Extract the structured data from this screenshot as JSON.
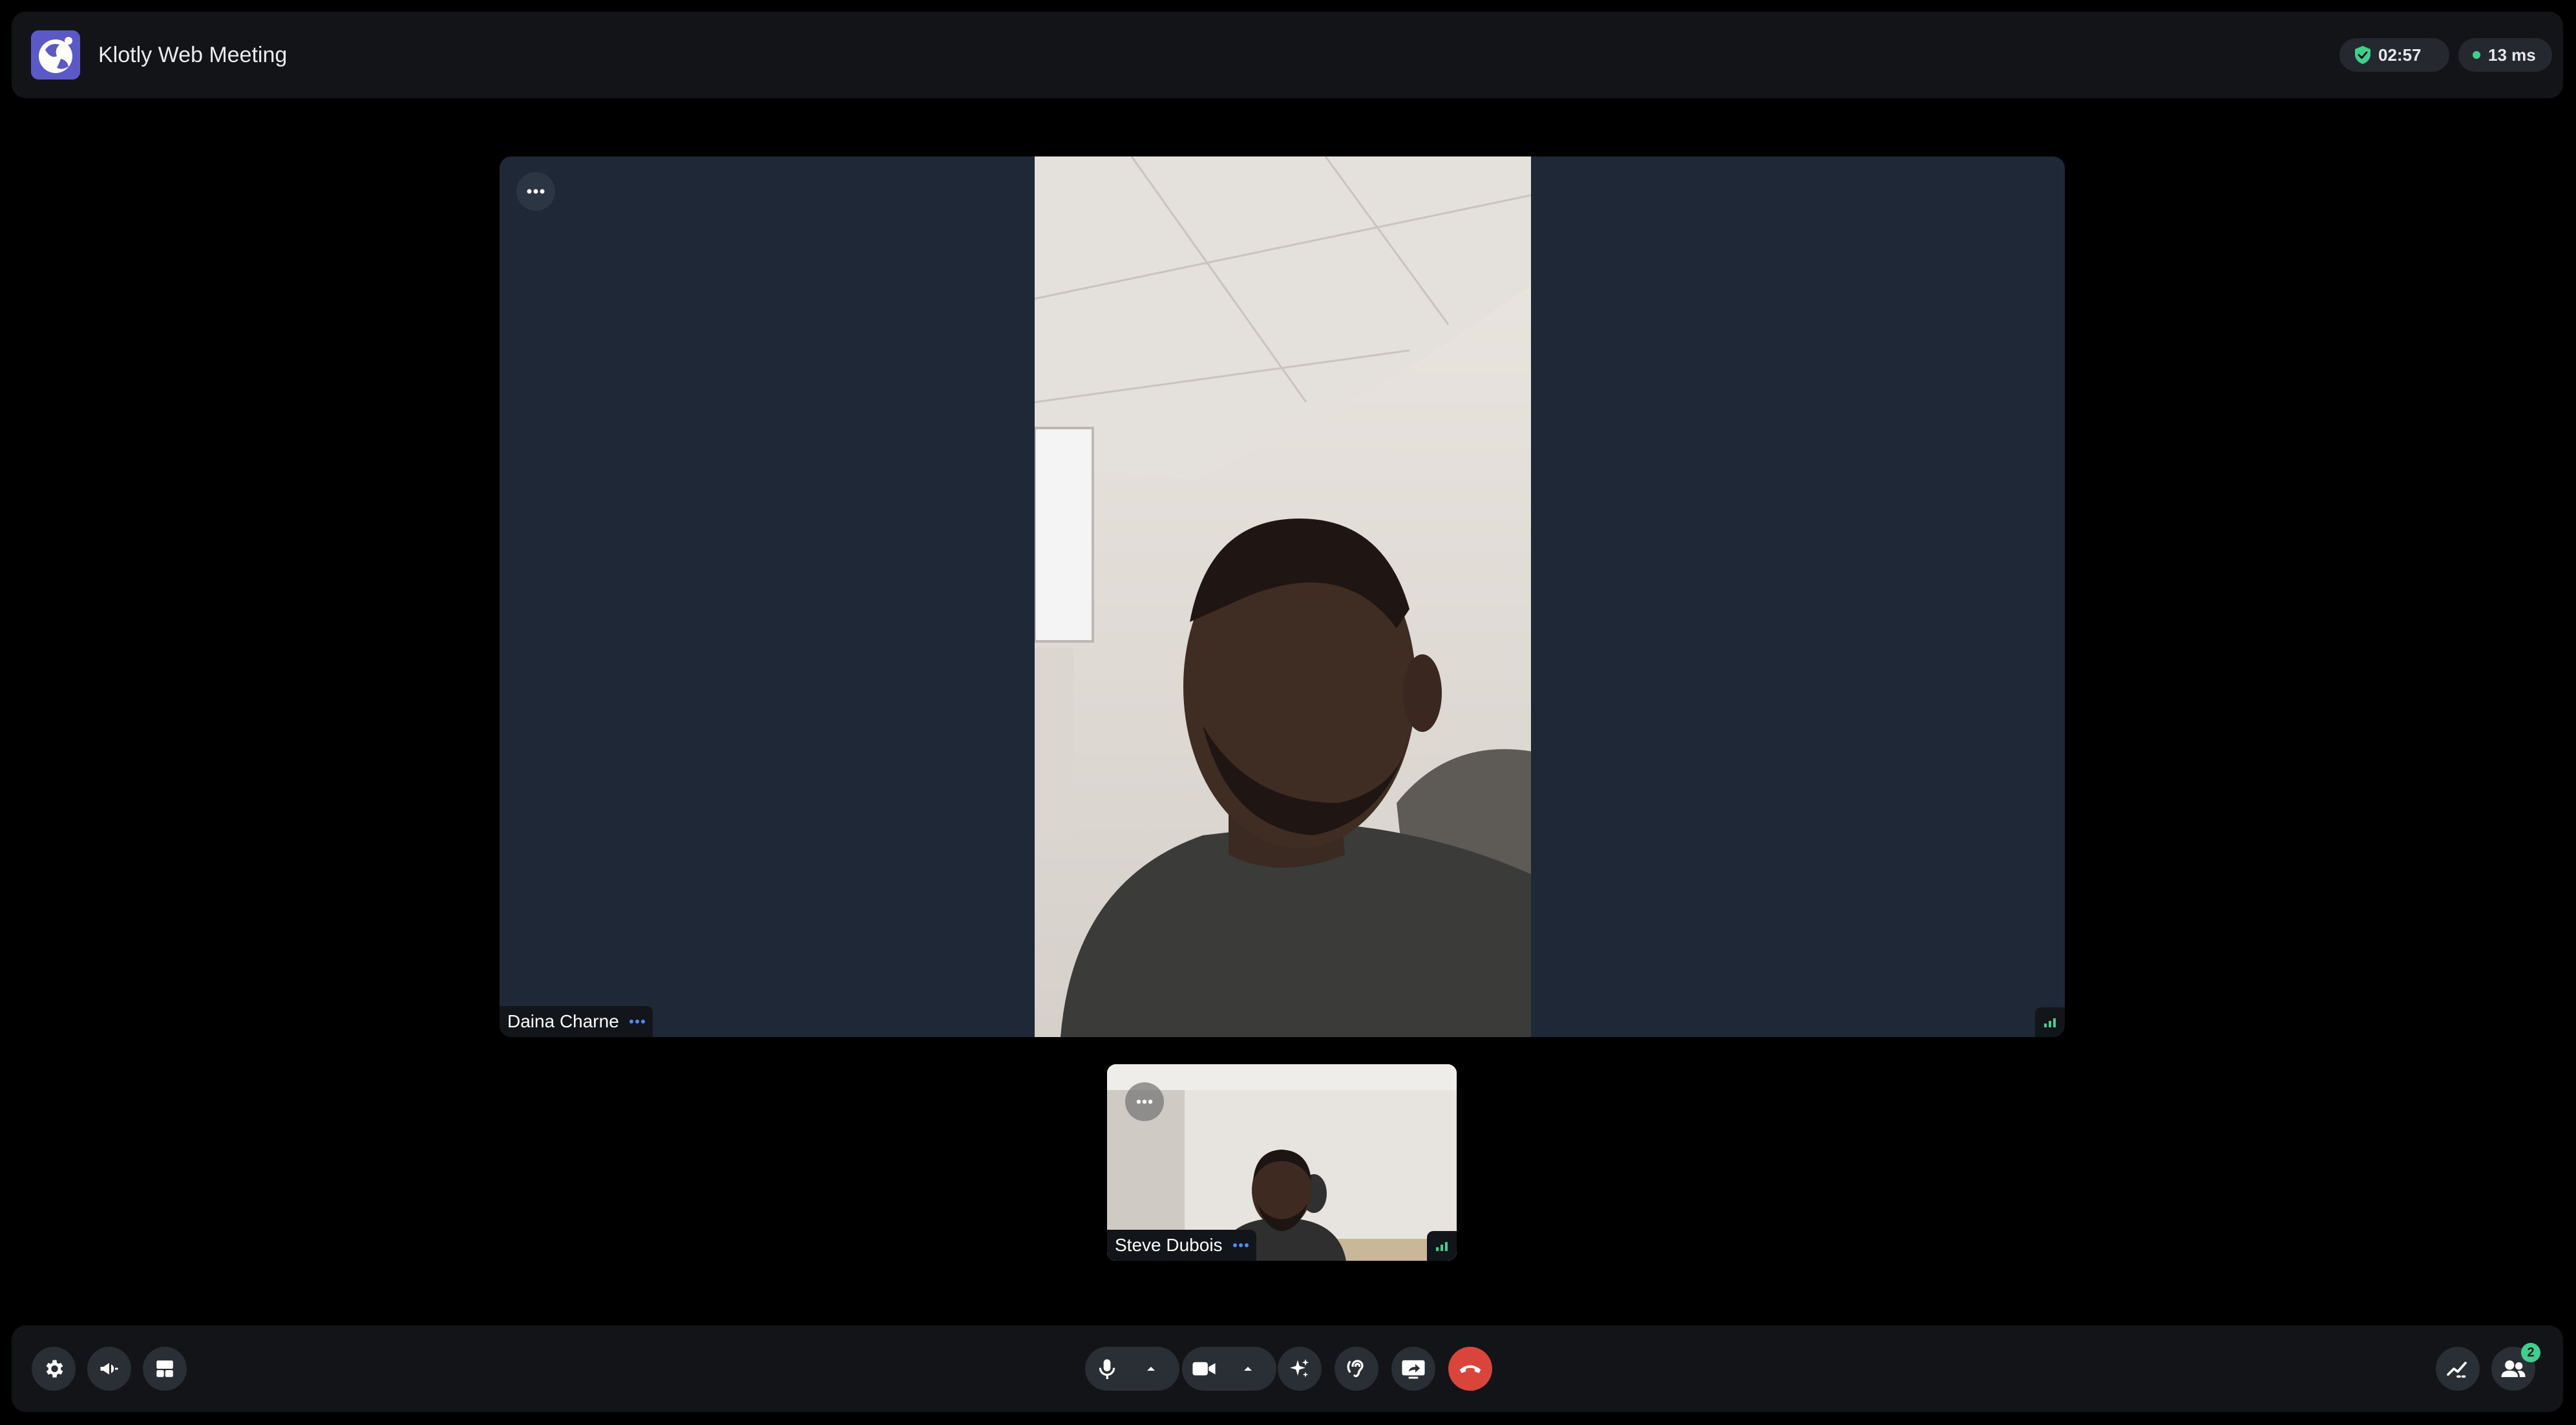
{
  "app": {
    "title": "Klotly Web Meeting",
    "timer": "02:57",
    "latency": "13 ms"
  },
  "participants": {
    "main": {
      "name": "Daina Charne"
    },
    "self": {
      "name": "Steve Dubois"
    }
  },
  "toolbar": {
    "participants_count": "2"
  },
  "colors": {
    "accent": "#5b58c7",
    "success": "#3ecf8e",
    "danger": "#d9453b",
    "tile_bg": "#1e2836"
  },
  "icons": [
    "logo-icon",
    "shield-check-icon",
    "more-icon",
    "signal-icon",
    "settings-icon",
    "megaphone-icon",
    "layout-icon",
    "microphone-icon",
    "chevron-up-icon",
    "camera-icon",
    "sparkles-icon",
    "hearing-icon",
    "screen-share-icon",
    "phone-hangup-icon",
    "activity-icon",
    "participants-icon"
  ]
}
